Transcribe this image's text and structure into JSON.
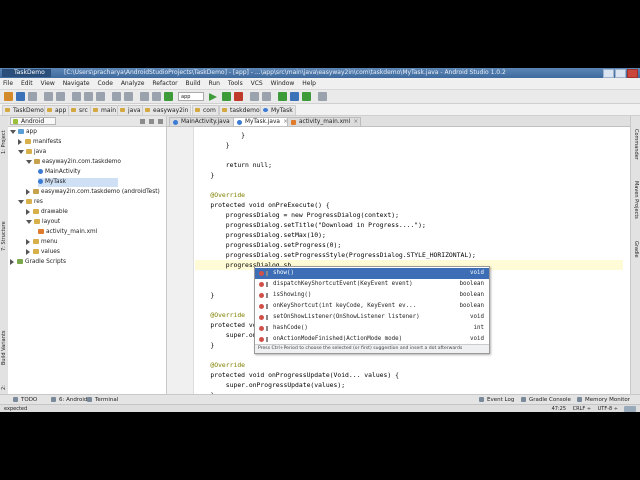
{
  "window": {
    "tab_label": "TaskDemo",
    "title": "[C:\\Users\\pracharya\\AndroidStudioProjects\\TaskDemo] - [app] - ...\\app\\src\\main\\java\\easyway2in\\com\\taskdemo\\MyTask.java - Android Studio 1.0.2"
  },
  "menu": [
    "File",
    "Edit",
    "View",
    "Navigate",
    "Code",
    "Analyze",
    "Refactor",
    "Build",
    "Run",
    "Tools",
    "VCS",
    "Window",
    "Help"
  ],
  "toolbar": {
    "run_config": "app"
  },
  "breadcrumbs": [
    "TaskDemo",
    "app",
    "src",
    "main",
    "java",
    "easyway2in",
    "com",
    "taskdemo",
    "MyTask"
  ],
  "project_panel": {
    "view_selector": "Android",
    "tree": [
      {
        "label": "app",
        "level": 0,
        "expanded": true,
        "icon": "module"
      },
      {
        "label": "manifests",
        "level": 1,
        "expanded": false,
        "icon": "folder"
      },
      {
        "label": "java",
        "level": 1,
        "expanded": true,
        "icon": "folder"
      },
      {
        "label": "easyway2in.com.taskdemo",
        "level": 2,
        "expanded": true,
        "icon": "package"
      },
      {
        "label": "MainActivity",
        "level": 3,
        "icon": "class"
      },
      {
        "label": "MyTask",
        "level": 3,
        "icon": "class",
        "selected": true
      },
      {
        "label": "easyway2in.com.taskdemo (androidTest)",
        "level": 2,
        "expanded": false,
        "icon": "package"
      },
      {
        "label": "res",
        "level": 1,
        "expanded": true,
        "icon": "folder"
      },
      {
        "label": "drawable",
        "level": 2,
        "expanded": false,
        "icon": "folder"
      },
      {
        "label": "layout",
        "level": 2,
        "expanded": true,
        "icon": "folder"
      },
      {
        "label": "activity_main.xml",
        "level": 3,
        "icon": "xml"
      },
      {
        "label": "menu",
        "level": 2,
        "expanded": false,
        "icon": "folder"
      },
      {
        "label": "values",
        "level": 2,
        "expanded": false,
        "icon": "folder"
      },
      {
        "label": "Gradle Scripts",
        "level": 0,
        "expanded": false,
        "icon": "gradle"
      }
    ]
  },
  "left_tool_windows": [
    "1: Project",
    "7: Structure",
    "Build Variants",
    "2: Favorites"
  ],
  "right_tool_windows": [
    "Commander",
    "Maven Projects",
    "Gradle"
  ],
  "editor_tabs": [
    {
      "label": "MainActivity.java",
      "type": "java",
      "active": false
    },
    {
      "label": "MyTask.java",
      "type": "java",
      "active": true
    },
    {
      "label": "activity_main.xml",
      "type": "xml",
      "active": false
    }
  ],
  "code_lines": [
    "            }",
    "        }",
    "",
    "        return null;",
    "    }",
    "",
    "    @Override",
    "    protected void onPreExecute() {",
    "        progressDialog = new ProgressDialog(context);",
    "        progressDialog.setTitle(\"Download in Progress....\");",
    "        progressDialog.setMax(10);",
    "        progressDialog.setProgress(0);",
    "        progressDialog.setProgressStyle(ProgressDialog.STYLE_HORIZONTAL);",
    "        progressDialog.sh",
    "",
    "",
    "    }",
    "",
    "    @Override",
    "    protected void onPo",
    "        super.onPo",
    "    }",
    "",
    "    @Override",
    "    protected void onProgressUpdate(Void... values) {",
    "        super.onProgressUpdate(values);",
    "    }"
  ],
  "autocomplete": {
    "items": [
      {
        "signature": "show()",
        "return": "void",
        "selected": true
      },
      {
        "signature": "dispatchKeyShortcutEvent(KeyEvent event)",
        "return": "boolean"
      },
      {
        "signature": "isShowing()",
        "return": "boolean"
      },
      {
        "signature": "onKeyShortcut(int keyCode, KeyEvent ev...",
        "return": "boolean"
      },
      {
        "signature": "setOnShowListener(OnShowListener listener)",
        "return": "void"
      },
      {
        "signature": "hashCode()",
        "return": "int"
      },
      {
        "signature": "onActionModeFinished(ActionMode mode)",
        "return": "void"
      }
    ],
    "hint": "Press Ctrl+Period to choose the selected (or first) suggestion and insert a dot afterwards"
  },
  "bottom_tools": {
    "left": [
      "TODO",
      "6: Android",
      "Terminal"
    ],
    "right": [
      "Event Log",
      "Gradle Console",
      "Memory Monitor"
    ]
  },
  "status": {
    "message": "expected",
    "position": "47:25",
    "line_sep": "CRLF ÷",
    "encoding": "UTF-8 ÷"
  }
}
